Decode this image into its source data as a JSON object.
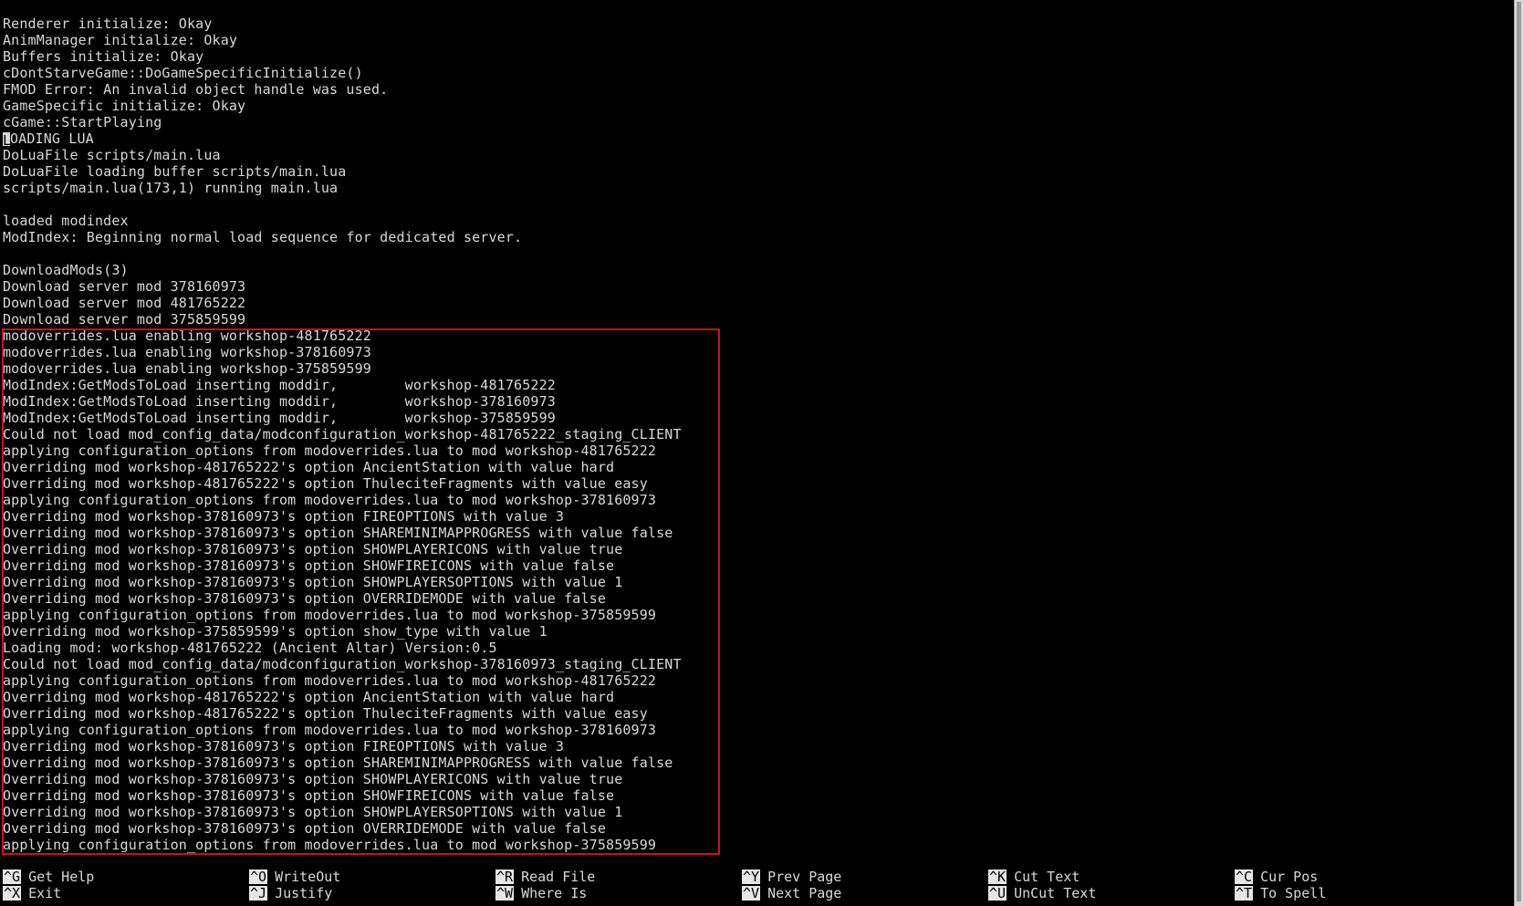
{
  "terminal": {
    "cursor_char": "L",
    "line_8_rest": "OADING LUA",
    "lines": [
      "Renderer initialize: Okay",
      "AnimManager initialize: Okay",
      "Buffers initialize: Okay",
      "cDontStarveGame::DoGameSpecificInitialize()",
      "FMOD Error: An invalid object handle was used.",
      "GameSpecific initialize: Okay",
      "cGame::StartPlaying",
      "LOADING LUA",
      "DoLuaFile scripts/main.lua",
      "DoLuaFile loading buffer scripts/main.lua",
      "scripts/main.lua(173,1) running main.lua",
      "",
      "loaded modindex",
      "ModIndex: Beginning normal load sequence for dedicated server.",
      "",
      "DownloadMods(3)",
      "Download server mod 378160973",
      "Download server mod 481765222",
      "Download server mod 375859599",
      "modoverrides.lua enabling workshop-481765222",
      "modoverrides.lua enabling workshop-378160973",
      "modoverrides.lua enabling workshop-375859599",
      "ModIndex:GetModsToLoad inserting moddir,        workshop-481765222",
      "ModIndex:GetModsToLoad inserting moddir,        workshop-378160973",
      "ModIndex:GetModsToLoad inserting moddir,        workshop-375859599",
      "Could not load mod_config_data/modconfiguration_workshop-481765222_staging_CLIENT",
      "applying configuration_options from modoverrides.lua to mod workshop-481765222",
      "Overriding mod workshop-481765222's option AncientStation with value hard",
      "Overriding mod workshop-481765222's option ThuleciteFragments with value easy",
      "applying configuration_options from modoverrides.lua to mod workshop-378160973",
      "Overriding mod workshop-378160973's option FIREOPTIONS with value 3",
      "Overriding mod workshop-378160973's option SHAREMINIMAPPROGRESS with value false",
      "Overriding mod workshop-378160973's option SHOWPLAYERICONS with value true",
      "Overriding mod workshop-378160973's option SHOWFIREICONS with value false",
      "Overriding mod workshop-378160973's option SHOWPLAYERSOPTIONS with value 1",
      "Overriding mod workshop-378160973's option OVERRIDEMODE with value false",
      "applying configuration_options from modoverrides.lua to mod workshop-375859599",
      "Overriding mod workshop-375859599's option show_type with value 1",
      "Loading mod: workshop-481765222 (Ancient Altar) Version:0.5",
      "Could not load mod_config_data/modconfiguration_workshop-378160973_staging_CLIENT",
      "applying configuration_options from modoverrides.lua to mod workshop-481765222",
      "Overriding mod workshop-481765222's option AncientStation with value hard",
      "Overriding mod workshop-481765222's option ThuleciteFragments with value easy",
      "applying configuration_options from modoverrides.lua to mod workshop-378160973",
      "Overriding mod workshop-378160973's option FIREOPTIONS with value 3",
      "Overriding mod workshop-378160973's option SHAREMINIMAPPROGRESS with value false",
      "Overriding mod workshop-378160973's option SHOWPLAYERICONS with value true",
      "Overriding mod workshop-378160973's option SHOWFIREICONS with value false",
      "Overriding mod workshop-378160973's option SHOWPLAYERSOPTIONS with value 1",
      "Overriding mod workshop-378160973's option OVERRIDEMODE with value false",
      "applying configuration_options from modoverrides.lua to mod workshop-375859599"
    ]
  },
  "shortcuts": [
    {
      "key": "^G",
      "label": "Get Help"
    },
    {
      "key": "^O",
      "label": "WriteOut"
    },
    {
      "key": "^R",
      "label": "Read File"
    },
    {
      "key": "^Y",
      "label": "Prev Page"
    },
    {
      "key": "^K",
      "label": "Cut Text"
    },
    {
      "key": "^C",
      "label": "Cur Pos"
    },
    {
      "key": "^X",
      "label": "Exit"
    },
    {
      "key": "^J",
      "label": "Justify"
    },
    {
      "key": "^W",
      "label": "Where Is"
    },
    {
      "key": "^V",
      "label": "Next Page"
    },
    {
      "key": "^U",
      "label": "UnCut Text"
    },
    {
      "key": "^T",
      "label": "To Spell"
    }
  ],
  "colors": {
    "background": "#000000",
    "text": "#d8d8d8",
    "highlight_border": "#c8101e",
    "key_bg": "#e6e6e6"
  }
}
